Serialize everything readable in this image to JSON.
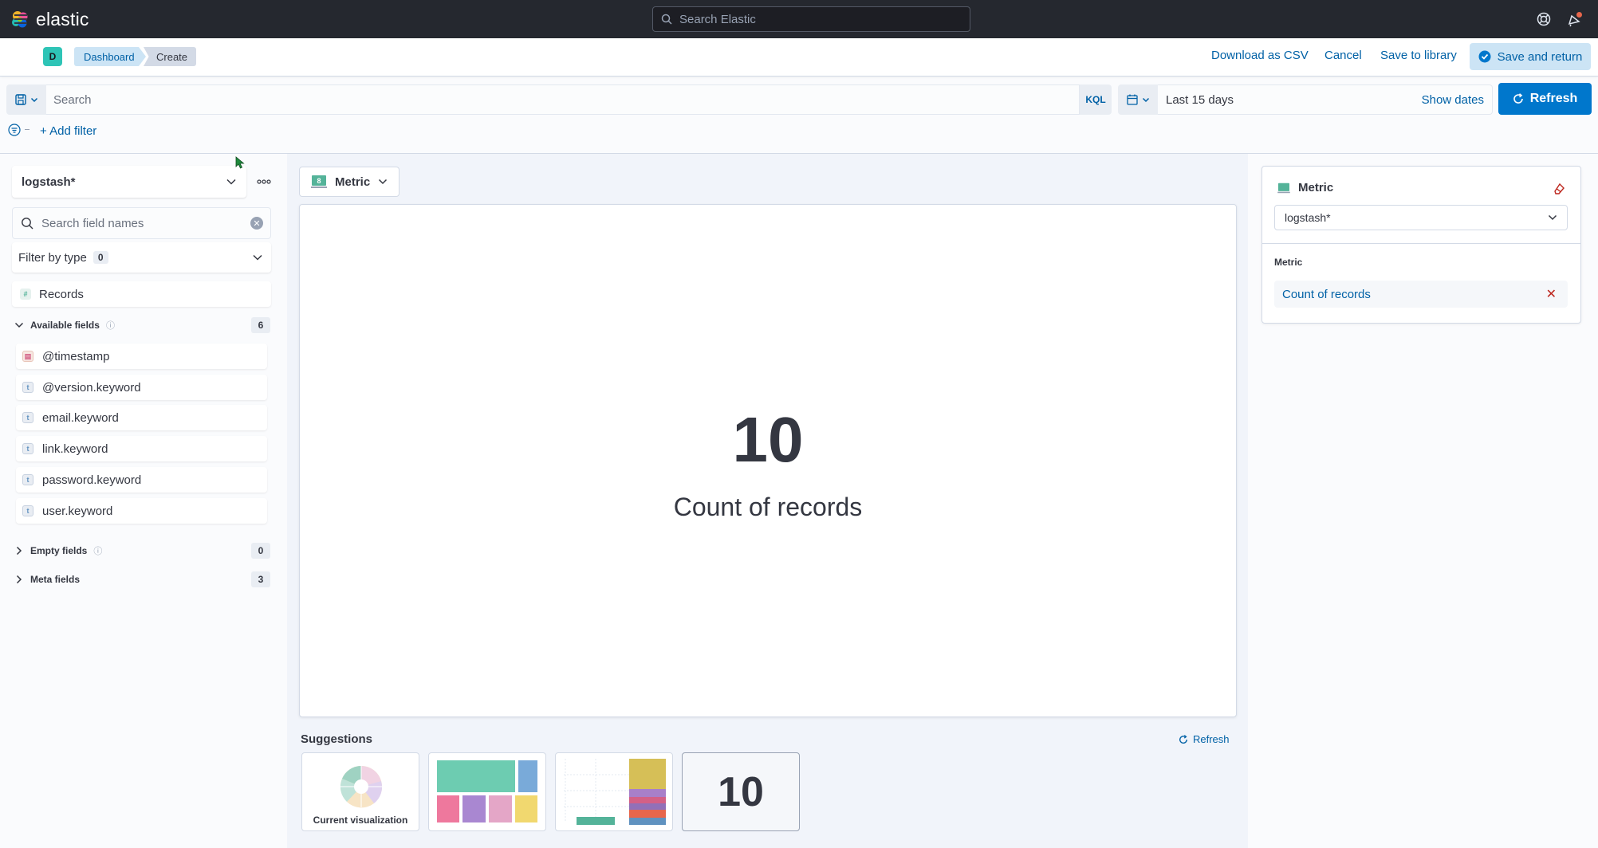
{
  "header": {
    "brand": "elastic",
    "search_placeholder": "Search Elastic",
    "help_icon": "help-icon",
    "notifications_icon": "newsfeed-icon"
  },
  "actionbar": {
    "space_initial": "D",
    "breadcrumbs": [
      "Dashboard",
      "Create"
    ],
    "download_csv": "Download as CSV",
    "cancel": "Cancel",
    "save_to_library": "Save to library",
    "save_and_return": "Save and return"
  },
  "query": {
    "search_placeholder": "Search",
    "language": "KQL",
    "date_range": "Last 15 days",
    "show_dates": "Show dates",
    "refresh": "Refresh",
    "add_filter": "+ Add filter"
  },
  "sidebar": {
    "index_pattern": "logstash*",
    "field_search_placeholder": "Search field names",
    "filter_by_type": "Filter by type",
    "filter_count": "0",
    "records": "Records",
    "available": {
      "label": "Available fields",
      "count": "6"
    },
    "fields": [
      "@timestamp",
      "@version.keyword",
      "email.keyword",
      "link.keyword",
      "password.keyword",
      "user.keyword"
    ],
    "empty": {
      "label": "Empty fields",
      "count": "0"
    },
    "meta": {
      "label": "Meta fields",
      "count": "3"
    }
  },
  "workspace": {
    "chart_type": "Metric",
    "metric_value": "10",
    "metric_label": "Count of records",
    "suggestions_title": "Suggestions",
    "suggestions_refresh": "Refresh",
    "suggestion_current": "Current visualization",
    "suggestion_metric_value": "10"
  },
  "config": {
    "layer_type": "Metric",
    "index_pattern": "logstash*",
    "metric_label": "Metric",
    "metric_item": "Count of records"
  },
  "colors": {
    "primary": "#0077cc",
    "link": "#0061a6",
    "header_bg": "#25282f",
    "danger": "#bd271e"
  }
}
